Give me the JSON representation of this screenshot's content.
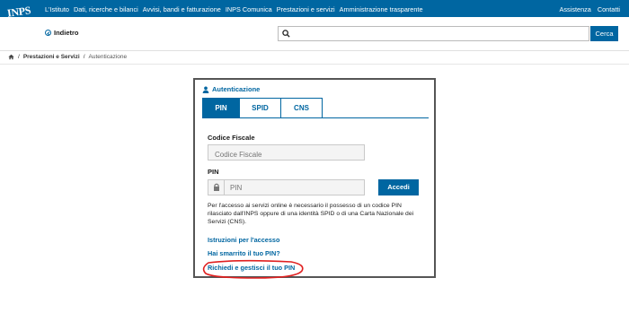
{
  "logo": {
    "text": "INPS"
  },
  "topnav": {
    "items": [
      "L'Istituto",
      "Dati, ricerche e bilanci",
      "Avvisi, bandi e fatturazione",
      "INPS Comunica",
      "Prestazioni e servizi",
      "Amministrazione trasparente"
    ],
    "right": [
      "Assistenza",
      "Contatti"
    ]
  },
  "header": {
    "back_label": "Indietro",
    "search_placeholder": "",
    "search_button": "Cerca"
  },
  "breadcrumb": {
    "items": [
      "Prestazioni e Servizi",
      "Autenticazione"
    ],
    "separator": "/"
  },
  "login": {
    "title": "Autenticazione",
    "tabs": [
      "PIN",
      "SPID",
      "CNS"
    ],
    "active_tab": "PIN",
    "codice_label": "Codice Fiscale",
    "codice_placeholder": "Codice Fiscale",
    "pin_label": "PIN",
    "pin_placeholder": "PIN",
    "submit_label": "Accedi",
    "info_text": "Per l'accesso ai servizi online è necessario il possesso di un codice PIN rilasciato dall'INPS oppure di una identità SPID o di una Carta Nazionale dei Servizi (CNS).",
    "links": [
      "Istruzioni per l'accesso",
      "Hai smarrito il tuo PIN?",
      "Richiedi e gestisci il tuo PIN"
    ]
  },
  "colors": {
    "brand": "#0066a1",
    "highlight": "#e02020"
  },
  "icons": {
    "home": "home-icon",
    "user": "user-icon",
    "lock": "lock-icon",
    "search": "search-icon",
    "back": "back-circle-icon"
  }
}
